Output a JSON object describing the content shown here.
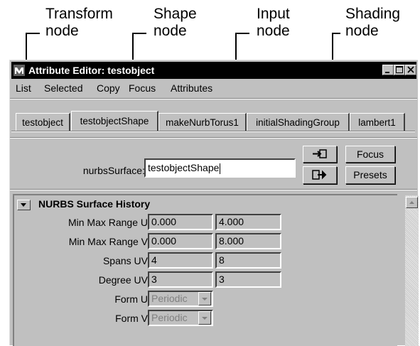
{
  "callouts": [
    {
      "line1": "Transform",
      "line2": "node"
    },
    {
      "line1": "Shape",
      "line2": "node"
    },
    {
      "line1": "Input",
      "line2": "node"
    },
    {
      "line1": "Shading",
      "line2": "node"
    }
  ],
  "window": {
    "title": "Attribute Editor: testobject",
    "app_icon": "maya-icon"
  },
  "menu": [
    "List",
    "Selected",
    "Copy",
    "Focus",
    "Attributes"
  ],
  "tabs": [
    "testobject",
    "testobjectShape",
    "makeNurbTorus1",
    "initialShadingGroup",
    "lambert1"
  ],
  "active_tab": "testobjectShape",
  "node_field": {
    "label": "nurbsSurface:",
    "value": "testobjectShape"
  },
  "buttons": {
    "focus": "Focus",
    "presets": "Presets"
  },
  "section": {
    "title": "NURBS Surface History"
  },
  "rows": [
    {
      "label": "Min Max Range U",
      "v1": "0.000",
      "v2": "4.000"
    },
    {
      "label": "Min Max Range V",
      "v1": "0.000",
      "v2": "8.000"
    },
    {
      "label": "Spans UV",
      "v1": "4",
      "v2": "8"
    },
    {
      "label": "Degree UV",
      "v1": "3",
      "v2": "3"
    },
    {
      "label": "Form U",
      "v1": "Periodic"
    },
    {
      "label": "Form V",
      "v1": "Periodic"
    }
  ]
}
